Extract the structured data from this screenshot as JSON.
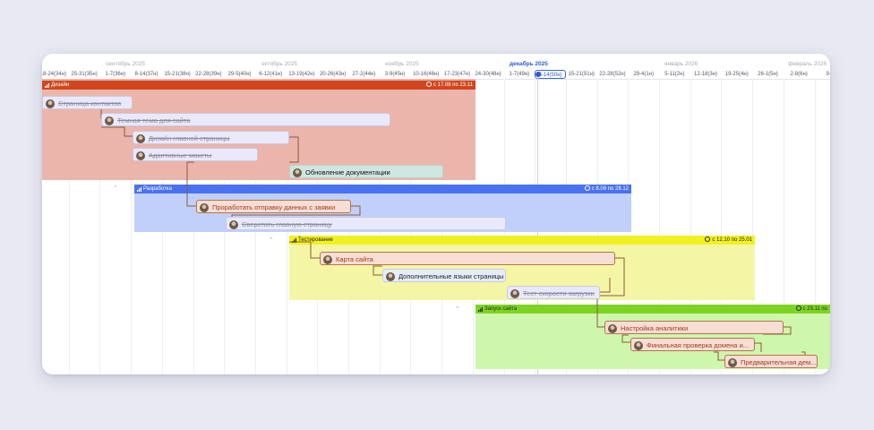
{
  "timeline": {
    "months": [
      "сентябрь 2025",
      "октябрь 2025",
      "ноябрь 2025",
      "декабрь 2025",
      "январь 2026",
      "февраль 2026"
    ],
    "weeks": [
      "18-24(34н)",
      "25-31(35н)",
      "1-7(36н)",
      "8-14(37н)",
      "15-21(38н)",
      "22-28(39н)",
      "29-5(40н)",
      "6-12(41н)",
      "13-19(42н)",
      "20-26(43н)",
      "27-2(44н)",
      "3-9(45н)",
      "10-16(46н)",
      "17-23(47н)",
      "24-30(48н)",
      "1-7(49н)",
      "8-14(50н)",
      "15-21(51н)",
      "22-28(52н)",
      "29-4(1н)",
      "5-11(2н)",
      "12-18(3н)",
      "19-25(4н)",
      "26-1(5н)",
      "2-8(6н)",
      "9-1"
    ],
    "current_week_index": 16,
    "current_month_index": 3
  },
  "groups": {
    "design": {
      "name": "Дизайн",
      "dates": "с 17.08 по 23.11",
      "color": "#d2461e"
    },
    "dev": {
      "name": "Разработка",
      "dates": "с 8.09 по 28.12",
      "color": "#4a72f0"
    },
    "test": {
      "name": "Тестирование",
      "dates": "с 12.10 по 25.01",
      "color": "#f1f121"
    },
    "launch": {
      "name": "Запуск сайта",
      "dates": "с 23.11 по",
      "color": "#7ed322"
    }
  },
  "tasks": {
    "t1": "Страница контактов",
    "t2": "Темная тема для сайта",
    "t3": "Дизайн главной страницы",
    "t4": "Адаптивные макеты",
    "t5": "Обновление документации",
    "t6": "Проработать отправку данных с заявки",
    "t7": "Сверстать главную страницу",
    "t8": "Карта сайта",
    "t9": "Дополнительные языки страницы",
    "t10": "Тест скорости загрузки",
    "t11": "Настройка аналитики",
    "t12": "Финальная проверка домена и...",
    "t13": "Предварительная дем..."
  }
}
